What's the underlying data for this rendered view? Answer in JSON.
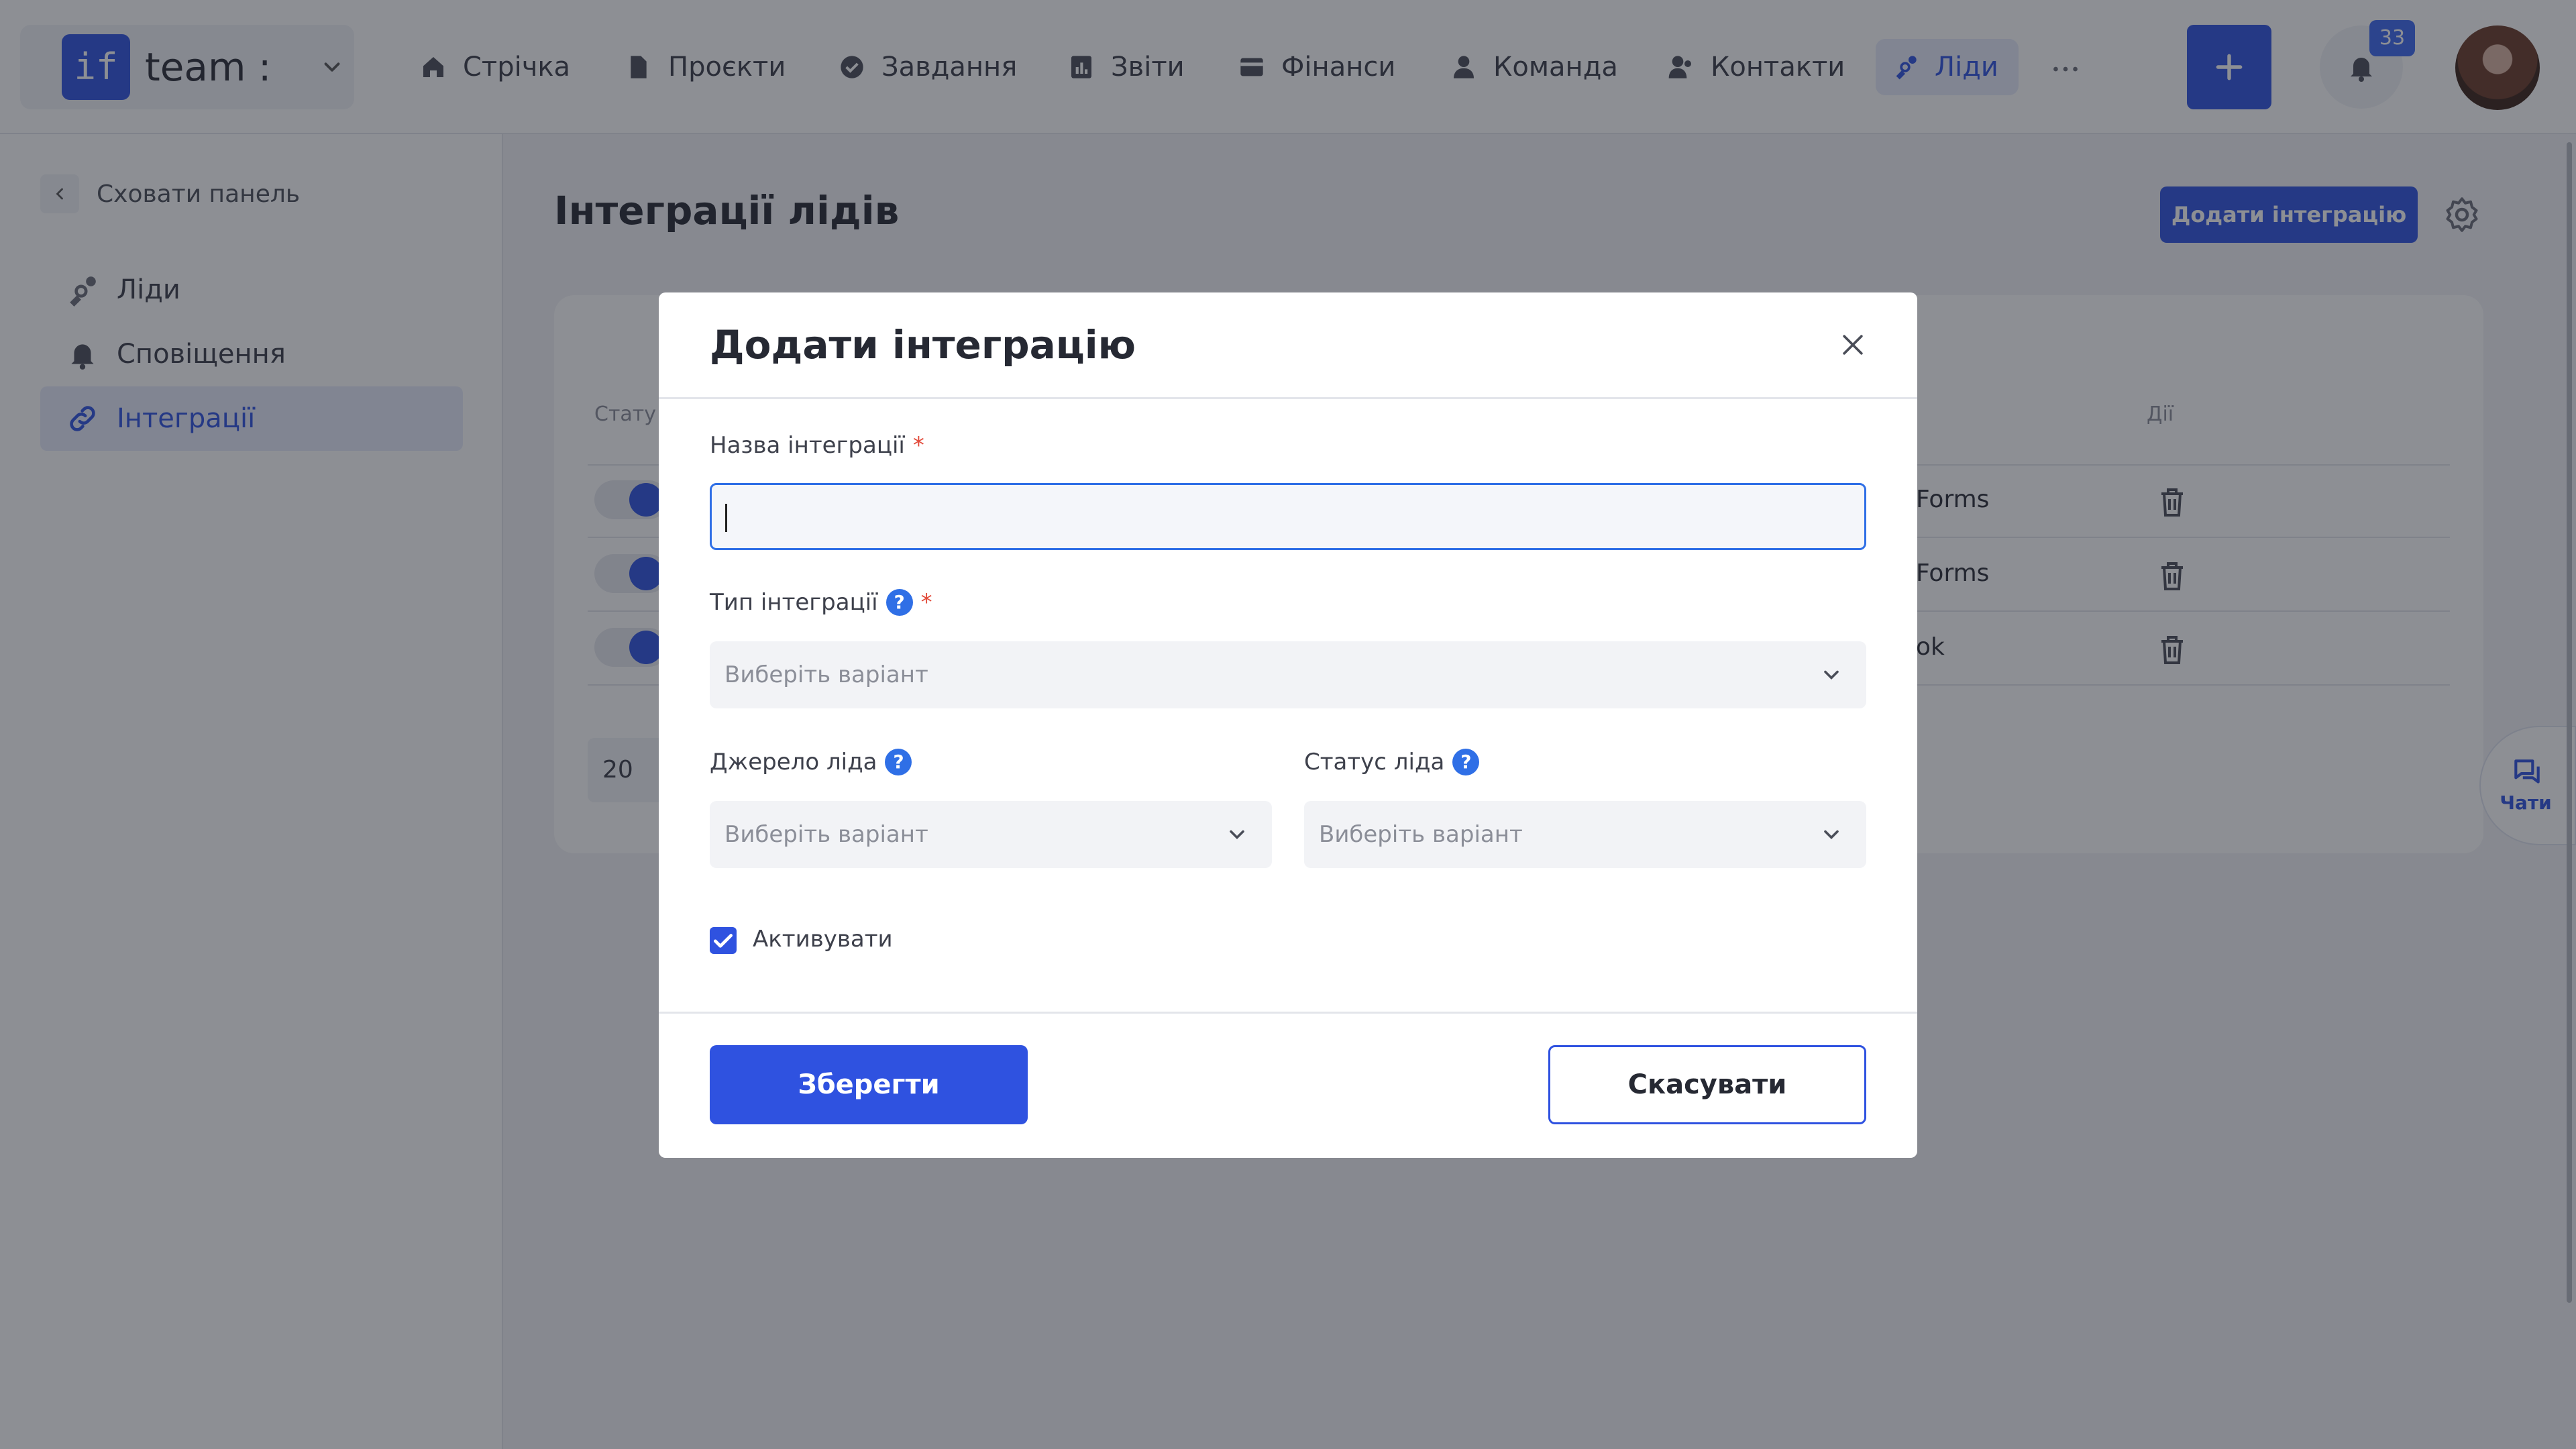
{
  "brand": {
    "logo_text": "if",
    "name": "team :"
  },
  "nav": {
    "items": [
      {
        "label": "Стрічка",
        "icon": "home-icon"
      },
      {
        "label": "Проєкти",
        "icon": "file-icon"
      },
      {
        "label": "Завдання",
        "icon": "check-circle-icon"
      },
      {
        "label": "Звіти",
        "icon": "report-icon"
      },
      {
        "label": "Фінанси",
        "icon": "wallet-icon"
      },
      {
        "label": "Команда",
        "icon": "user-icon"
      },
      {
        "label": "Контакти",
        "icon": "contacts-icon"
      },
      {
        "label": "Ліди",
        "icon": "leads-icon"
      }
    ],
    "active": "Ліди"
  },
  "notifications": {
    "count": "33"
  },
  "sidebar": {
    "hide_label": "Сховати панель",
    "items": [
      {
        "label": "Ліди",
        "icon": "leads-icon"
      },
      {
        "label": "Сповіщення",
        "icon": "bell-icon"
      },
      {
        "label": "Інтеграції",
        "icon": "link-icon"
      }
    ],
    "active": "Інтеграції"
  },
  "main": {
    "title": "Інтеграції лідів",
    "add_button": "Додати інтеграцію",
    "table": {
      "headers": {
        "status": "Стату",
        "actions": "Дії"
      },
      "rows": [
        {
          "source": "Forms"
        },
        {
          "source": "Forms"
        },
        {
          "source": "ok"
        }
      ],
      "page_size": "20"
    }
  },
  "chats": {
    "label": "Чати"
  },
  "modal": {
    "title": "Додати інтеграцію",
    "name_label": "Назва інтеграції",
    "name_value": "",
    "required_mark": "*",
    "type_label": "Тип інтеграції",
    "type_placeholder": "Виберіть варіант",
    "source_label": "Джерело ліда",
    "source_placeholder": "Виберіть варіант",
    "status_label": "Статус ліда",
    "status_placeholder": "Виберіть варіант",
    "help_mark": "?",
    "activate_label": "Активувати",
    "activate_checked": true,
    "save_label": "Зберегти",
    "cancel_label": "Скасувати"
  },
  "colors": {
    "accent": "#2f52e0",
    "help": "#2f6fe6",
    "required": "#e24b3b"
  }
}
